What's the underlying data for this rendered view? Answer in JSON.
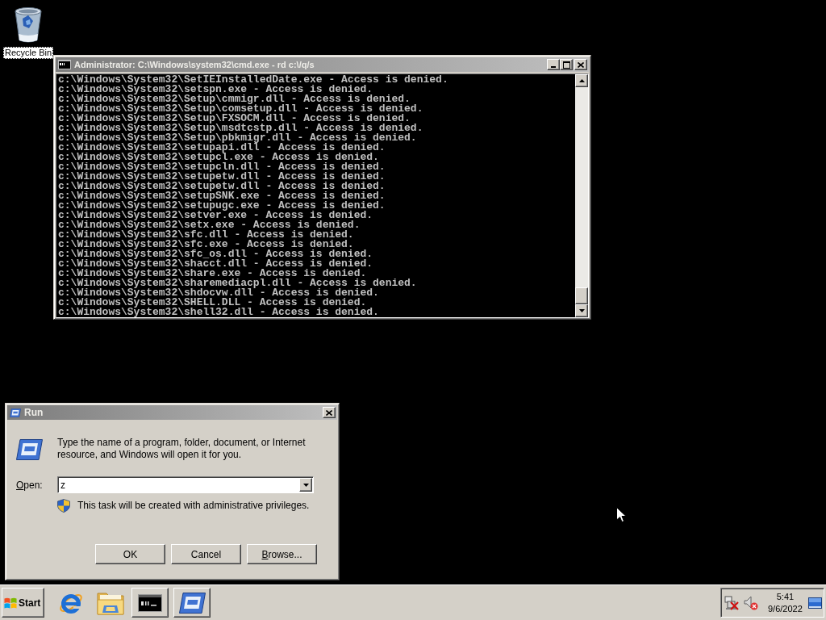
{
  "desktop": {
    "icons": [
      {
        "label": "Recycle Bin",
        "focused": true
      }
    ]
  },
  "console_window": {
    "title": "Administrator: C:\\Windows\\system32\\cmd.exe - rd c:\\/q/s",
    "active": false,
    "lines": [
      "c:\\Windows\\System32\\SetIEInstalledDate.exe - Access is denied.",
      "c:\\Windows\\System32\\setspn.exe - Access is denied.",
      "c:\\Windows\\System32\\Setup\\cmmigr.dll - Access is denied.",
      "c:\\Windows\\System32\\Setup\\comsetup.dll - Access is denied.",
      "c:\\Windows\\System32\\Setup\\FXSOCM.dll - Access is denied.",
      "c:\\Windows\\System32\\Setup\\msdtcstp.dll - Access is denied.",
      "c:\\Windows\\System32\\Setup\\pbkmigr.dll - Access is denied.",
      "c:\\Windows\\System32\\setupapi.dll - Access is denied.",
      "c:\\Windows\\System32\\setupcl.exe - Access is denied.",
      "c:\\Windows\\System32\\setupcln.dll - Access is denied.",
      "c:\\Windows\\System32\\setupetw.dll - Access is denied.",
      "c:\\Windows\\System32\\setupetw.dll - Access is denied.",
      "c:\\Windows\\System32\\setupSNK.exe - Access is denied.",
      "c:\\Windows\\System32\\setupugc.exe - Access is denied.",
      "c:\\Windows\\System32\\setver.exe - Access is denied.",
      "c:\\Windows\\System32\\setx.exe - Access is denied.",
      "c:\\Windows\\System32\\sfc.dll - Access is denied.",
      "c:\\Windows\\System32\\sfc.exe - Access is denied.",
      "c:\\Windows\\System32\\sfc_os.dll - Access is denied.",
      "c:\\Windows\\System32\\shacct.dll - Access is denied.",
      "c:\\Windows\\System32\\share.exe - Access is denied.",
      "c:\\Windows\\System32\\sharemediacpl.dll - Access is denied.",
      "c:\\Windows\\System32\\shdocvw.dll - Access is denied.",
      "c:\\Windows\\System32\\SHELL.DLL - Access is denied.",
      "c:\\Windows\\System32\\shell32.dll - Access is denied."
    ]
  },
  "run_dialog": {
    "title": "Run",
    "active": false,
    "description": "Type the name of a program, folder, document, or Internet resource, and Windows will open it for you.",
    "open_label": {
      "text": "Open:",
      "mnemonic": true
    },
    "open_value": "z",
    "notice": "This task will be created with administrative privileges.",
    "buttons": [
      {
        "label": "OK",
        "mnemonic": false
      },
      {
        "label": "Cancel",
        "mnemonic": false
      },
      {
        "label": "Browse...",
        "mnemonic": true
      }
    ]
  },
  "taskbar": {
    "start_label": "Start",
    "clock": {
      "time": "5:41",
      "date": "9/6/2022"
    }
  }
}
